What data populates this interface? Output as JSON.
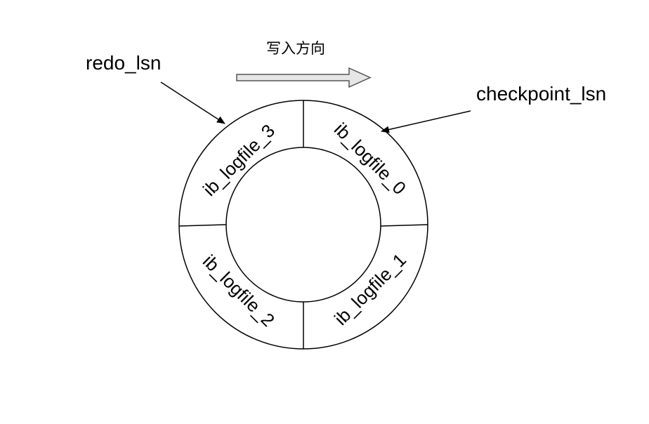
{
  "direction_label": "写入方向",
  "pointers": {
    "redo_lsn": "redo_lsn",
    "checkpoint_lsn": "checkpoint_lsn"
  },
  "ring": {
    "segments": [
      {
        "id": "ib_logfile_0",
        "label": "ib_logfile_0"
      },
      {
        "id": "ib_logfile_1",
        "label": "ib_logfile_1"
      },
      {
        "id": "ib_logfile_2",
        "label": "ib_logfile_2"
      },
      {
        "id": "ib_logfile_3",
        "label": "ib_logfile_3"
      }
    ]
  },
  "colors": {
    "stroke": "#000000",
    "arrow_fill": "#e6e6e6",
    "arrow_stroke": "#555555",
    "background": "#ffffff"
  }
}
